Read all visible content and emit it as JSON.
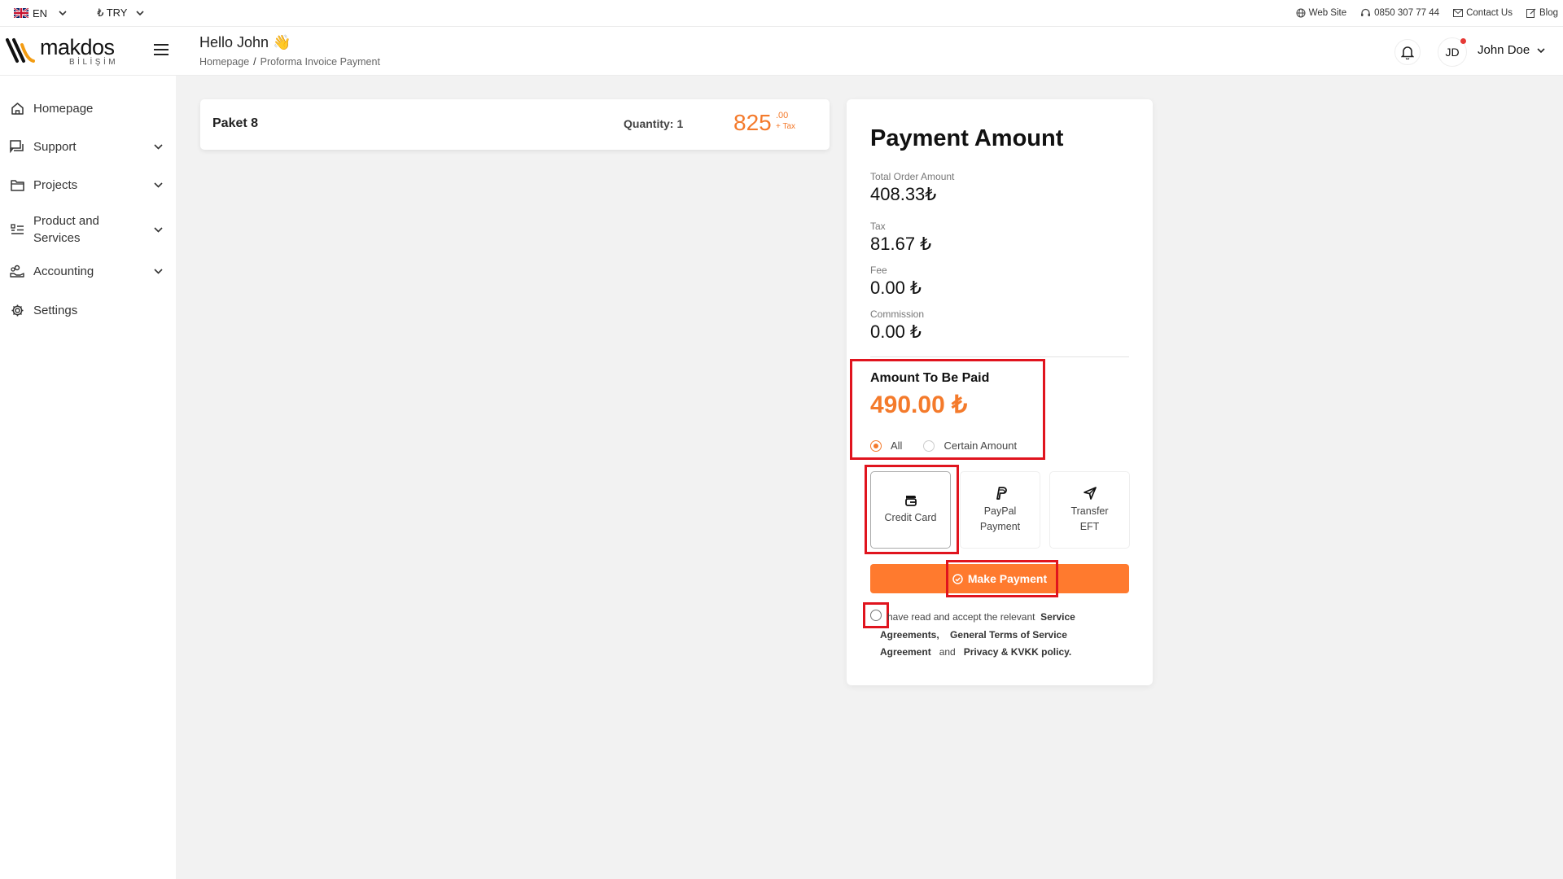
{
  "topbar": {
    "language": "EN",
    "currency": "₺ TRY",
    "links": {
      "website": "Web Site",
      "phone": "0850 307 77 44",
      "contact": "Contact Us",
      "blog": "Blog"
    }
  },
  "header": {
    "logo_word": "makdos",
    "logo_sub": "BİLİŞİM",
    "greeting": "Hello John 👋",
    "breadcrumb": [
      "Homepage",
      "/",
      "Proforma Invoice Payment"
    ],
    "avatar_initials": "JD",
    "username": "John Doe"
  },
  "sidebar": {
    "items": [
      {
        "label": "Homepage",
        "icon": "home-icon"
      },
      {
        "label": "Support",
        "icon": "support-icon"
      },
      {
        "label": "Projects",
        "icon": "folder-icon"
      },
      {
        "label": "Product and Services",
        "icon": "list-icon"
      },
      {
        "label": "Accounting",
        "icon": "accounting-icon"
      },
      {
        "label": "Settings",
        "icon": "gear-icon"
      }
    ]
  },
  "product": {
    "name": "Paket 8",
    "quantity_label": "Quantity:",
    "quantity": "1",
    "price": "825",
    "cents": ".00",
    "tax_note": "+ Tax"
  },
  "payment": {
    "title": "Payment Amount",
    "total_label": "Total Order Amount",
    "total_value": "408.33₺",
    "tax_label": "Tax",
    "tax_value": "81.67 ₺",
    "fee_label": "Fee",
    "fee_value": "0.00 ₺",
    "commission_label": "Commission",
    "commission_value": "0.00 ₺",
    "to_be_paid_label": "Amount To Be Paid",
    "to_be_paid_value": "490.00 ₺",
    "option_all": "All",
    "option_certain": "Certain Amount",
    "selected_option": "All",
    "methods": {
      "credit_card": "Credit Card",
      "paypal_1": "PayPal",
      "paypal_2": "Payment",
      "transfer_1": "Transfer",
      "transfer_2": "EFT"
    },
    "selected_method": "Credit Card",
    "button": "Make Payment",
    "agreement": {
      "prefix": "have read and accept the relevant",
      "link1a": "Service",
      "link1b": "Agreements,",
      "link2": "General Terms of Service",
      "link2b": "Agreement",
      "and": "and",
      "link3": "Privacy & KVKK policy."
    }
  },
  "colors": {
    "accent": "#ff7a2e",
    "price": "#f47a2b",
    "highlight": "#e0141e"
  }
}
